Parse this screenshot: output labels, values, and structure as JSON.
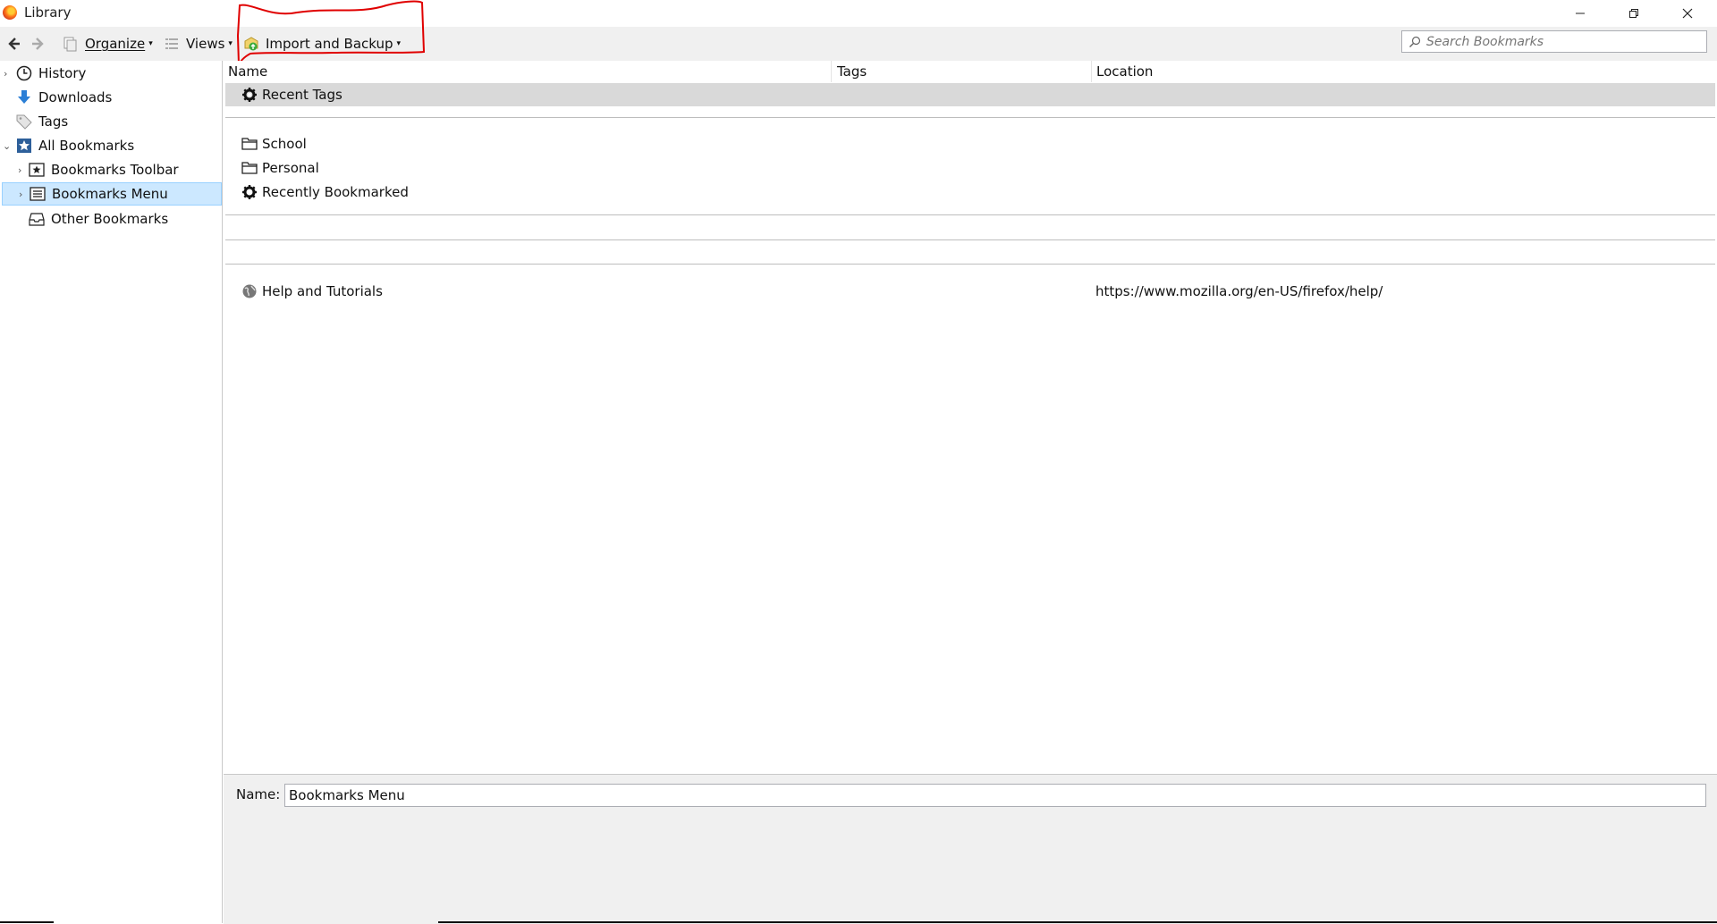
{
  "window": {
    "title": "Library",
    "controls": {
      "minimize": "—",
      "maximize": "❐",
      "close": "✕"
    }
  },
  "toolbar": {
    "back_icon": "back-arrow-icon",
    "forward_icon": "forward-arrow-icon",
    "organize_label": "Organize",
    "views_label": "Views",
    "import_backup_label": "Import and Backup",
    "caret": "▾",
    "search_placeholder": "Search Bookmarks"
  },
  "annotation": {
    "color": "#e00000",
    "shape": "hand-drawn-outline"
  },
  "sidebar": {
    "items": [
      {
        "label": "History",
        "icon": "clock-icon",
        "expander": "›"
      },
      {
        "label": "Downloads",
        "icon": "download-arrow-icon",
        "expander": ""
      },
      {
        "label": "Tags",
        "icon": "tag-icon",
        "expander": ""
      },
      {
        "label": "All Bookmarks",
        "icon": "bookmarks-star-icon",
        "expander": "⌄"
      },
      {
        "label": "Bookmarks Toolbar",
        "icon": "star-box-icon",
        "expander": "›"
      },
      {
        "label": "Bookmarks Menu",
        "icon": "menu-list-icon",
        "expander": "›",
        "selected": true
      },
      {
        "label": "Other Bookmarks",
        "icon": "inbox-tray-icon",
        "expander": ""
      }
    ],
    "selected_color": "#cce8ff"
  },
  "list": {
    "columns": [
      "Name",
      "Tags",
      "Location"
    ],
    "rows": [
      {
        "name": "Recent Tags",
        "icon": "gear-icon",
        "location": ""
      },
      {
        "name": "School",
        "icon": "folder-icon",
        "location": ""
      },
      {
        "name": "Personal",
        "icon": "folder-icon",
        "location": ""
      },
      {
        "name": "Recently Bookmarked",
        "icon": "gear-icon",
        "location": ""
      },
      {
        "name": "Help and Tutorials",
        "icon": "globe-icon",
        "location": "https://www.mozilla.org/en-US/firefox/help/"
      }
    ]
  },
  "details": {
    "name_label": "Name:",
    "name_value": "Bookmarks Menu"
  }
}
